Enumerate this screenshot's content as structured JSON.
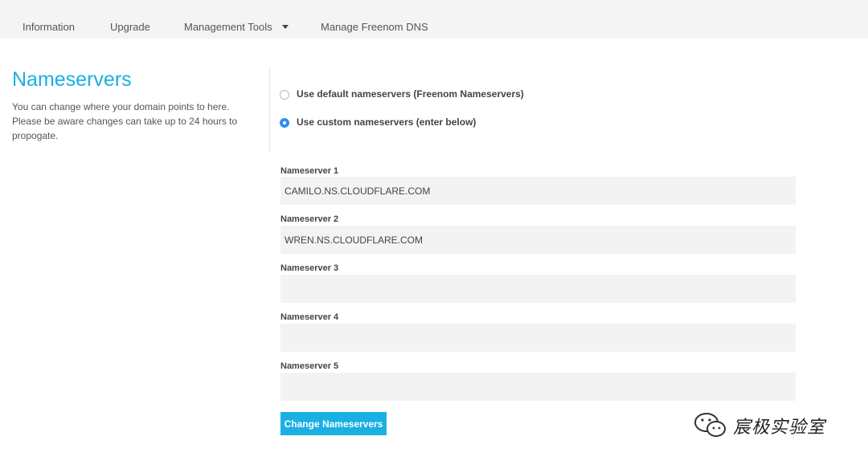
{
  "nav": {
    "items": [
      {
        "label": "Information"
      },
      {
        "label": "Upgrade"
      },
      {
        "label": "Management Tools"
      },
      {
        "label": "Manage Freenom DNS"
      }
    ]
  },
  "section": {
    "title": "Nameservers",
    "description": "You can change where your domain points to here. Please be aware changes can take up to 24 hours to propogate."
  },
  "options": [
    {
      "label": "Use default nameservers (Freenom Nameservers)",
      "selected": false
    },
    {
      "label": "Use custom nameservers (enter below)",
      "selected": true
    }
  ],
  "nameservers": [
    {
      "label": "Nameserver 1",
      "value": "CAMILO.NS.CLOUDFLARE.COM"
    },
    {
      "label": "Nameserver 2",
      "value": "WREN.NS.CLOUDFLARE.COM"
    },
    {
      "label": "Nameserver 3",
      "value": ""
    },
    {
      "label": "Nameserver 4",
      "value": ""
    },
    {
      "label": "Nameserver 5",
      "value": ""
    }
  ],
  "submit_label": "Change Nameservers",
  "watermark": {
    "text": "宸极实验室"
  },
  "colors": {
    "accent": "#1ab0e3",
    "radio_selected": "#2e8ef0",
    "input_bg": "#f3f3f3",
    "nav_bg": "#f4f4f4"
  }
}
